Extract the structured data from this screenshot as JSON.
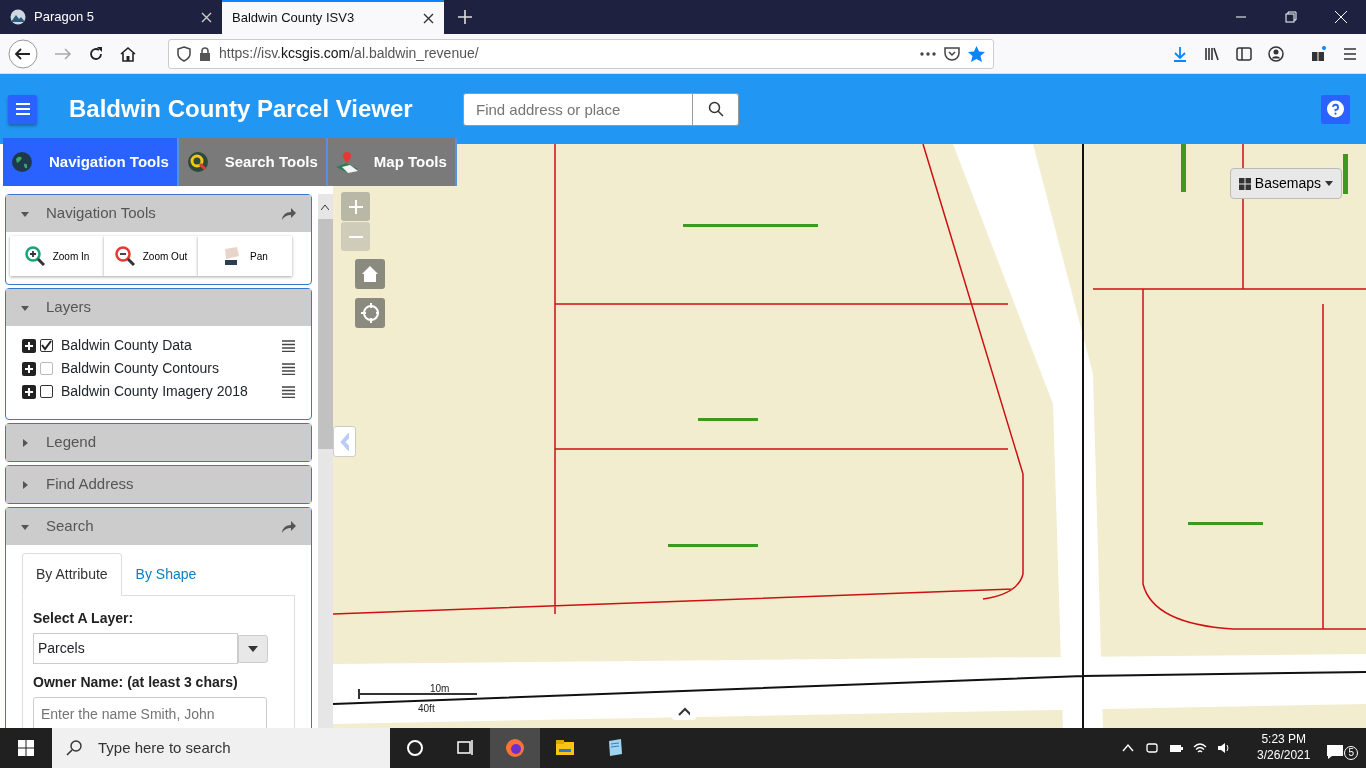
{
  "browser": {
    "tabs": [
      {
        "title": "Paragon 5",
        "selected": false
      },
      {
        "title": "Baldwin County ISV3",
        "selected": true
      }
    ],
    "url": {
      "scheme": "https://isv.",
      "domain": "kcsgis.com",
      "path": "/al.baldwin_revenue/"
    }
  },
  "app": {
    "title": "Baldwin County Parcel Viewer",
    "search": {
      "placeholder": "Find address or place"
    }
  },
  "tool_tabs": [
    {
      "label": "Navigation Tools",
      "selected": true
    },
    {
      "label": "Search Tools",
      "selected": false
    },
    {
      "label": "Map Tools",
      "selected": false
    }
  ],
  "panels": [
    {
      "kind": "tools",
      "title": "Navigation Tools",
      "expanded": true,
      "buttons": [
        "Zoom In",
        "Zoom Out",
        "Pan"
      ]
    },
    {
      "kind": "layers",
      "title": "Layers",
      "expanded": true,
      "layers": [
        {
          "name": "Baldwin County Data",
          "checked": true
        },
        {
          "name": "Baldwin County Contours",
          "checked": false
        },
        {
          "name": "Baldwin County Imagery 2018",
          "checked": false
        }
      ]
    },
    {
      "kind": "plain",
      "title": "Legend",
      "expanded": false
    },
    {
      "kind": "plain",
      "title": "Find Address",
      "expanded": false
    },
    {
      "kind": "search",
      "title": "Search",
      "expanded": true,
      "tabs": [
        {
          "label": "By Attribute",
          "selected": true
        },
        {
          "label": "By Shape",
          "selected": false
        }
      ],
      "layer_label": "Select A Layer:",
      "layer_value": "Parcels",
      "owner_label": "Owner Name: (at least 3 chars)",
      "owner_placeholder": "Enter the name Smith, John"
    }
  ],
  "map": {
    "basemaps": "Basemaps",
    "scale": [
      "10m",
      "40ft"
    ]
  },
  "taskbar": {
    "search_placeholder": "Type here to search",
    "time": "5:23 PM",
    "date": "3/26/2021",
    "notifications": "5"
  }
}
